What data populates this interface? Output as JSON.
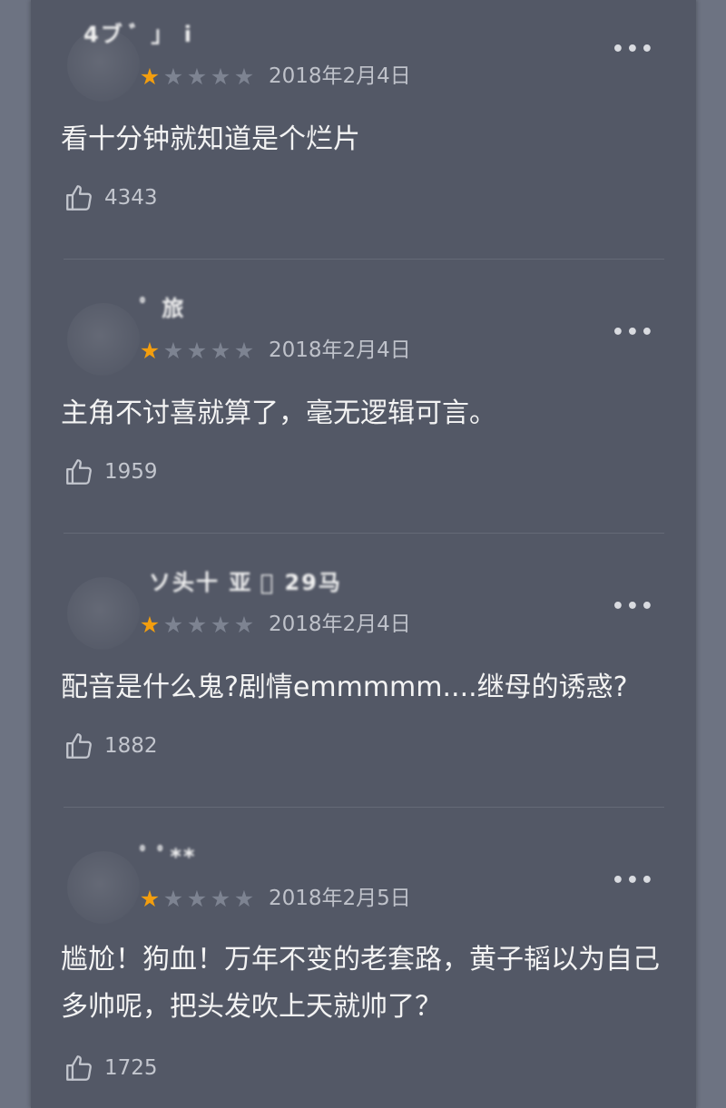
{
  "reviews": [
    {
      "username": "4ブ ﾞ 」 i",
      "rating": 1,
      "max_rating": 5,
      "date": "2018年2月4日",
      "content": "看十分钟就知道是个烂片",
      "likes": "4343",
      "more_icon": "more-horizontal-icon"
    },
    {
      "username": "ﾟ 旅",
      "rating": 1,
      "max_rating": 5,
      "date": "2018年2月4日",
      "content": "主角不讨喜就算了，毫无逻辑可言。",
      "likes": "1959",
      "more_icon": "more-horizontal-icon"
    },
    {
      "username": "ソ头十 亚 ゙ 29马",
      "rating": 1,
      "max_rating": 5,
      "date": "2018年2月4日",
      "content": "配音是什么鬼?剧情emmmmm....继母的诱惑?",
      "likes": "1882",
      "more_icon": "more-horizontal-icon"
    },
    {
      "username": "ﾟ ﾟ**",
      "rating": 1,
      "max_rating": 5,
      "date": "2018年2月5日",
      "content": "尴尬！狗血！万年不变的老套路，黄子韬以为自己多帅呢，把头发吹上天就帅了？",
      "likes": "1725",
      "more_icon": "more-horizontal-icon"
    }
  ],
  "colors": {
    "background": "#6d7382",
    "panel": "#535866",
    "star_on": "#f39e0e",
    "star_off": "#7d8391"
  }
}
